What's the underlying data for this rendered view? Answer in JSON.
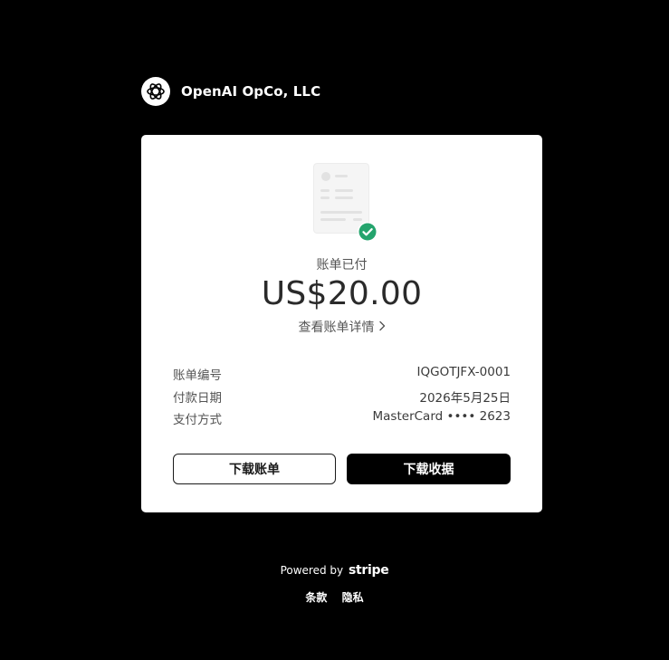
{
  "merchant": {
    "name": "OpenAI OpCo, LLC",
    "logo_icon": "openai-logo-icon"
  },
  "invoice": {
    "status": "账单已付",
    "amount": "US$20.00",
    "details_link": "查看账单详情",
    "rows": [
      {
        "label": "账单编号",
        "value": "IQGOTJFX-0001"
      },
      {
        "label": "付款日期",
        "value": "2026年5月25日"
      },
      {
        "label": "支付方式",
        "value": "MasterCard •••• 2623"
      }
    ]
  },
  "actions": {
    "download_invoice": "下载账单",
    "download_receipt": "下载收据"
  },
  "footer": {
    "powered_by": "Powered by",
    "brand": "stripe",
    "links": [
      "条款",
      "隐私"
    ]
  },
  "colors": {
    "background": "#000000",
    "card": "#ffffff",
    "success": "#24a46d"
  }
}
